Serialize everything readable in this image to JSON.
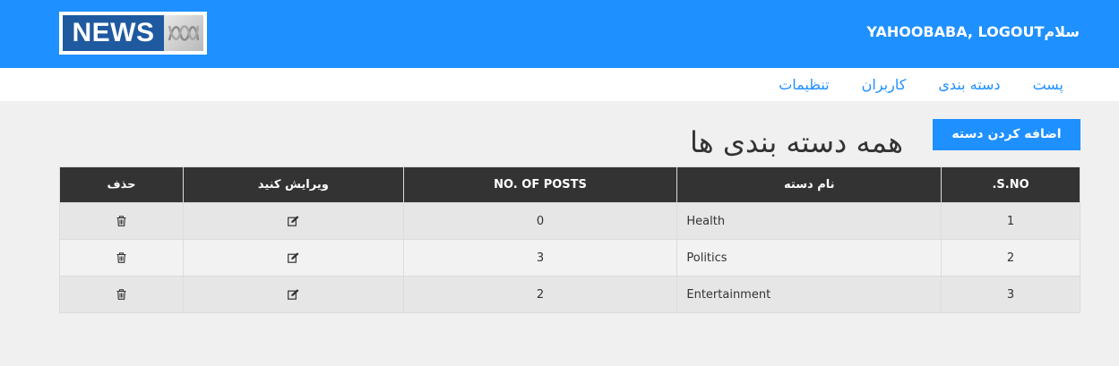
{
  "header": {
    "logo_text": "NEWS",
    "logo_mark_icon": "abc-logo-icon",
    "user_text": "سلامYAHOOBABA, LOGOUT"
  },
  "menu": {
    "items": [
      {
        "label": "پست"
      },
      {
        "label": "دسته بندی"
      },
      {
        "label": "کاربران"
      },
      {
        "label": "تنظیمات"
      }
    ]
  },
  "page": {
    "title": "همه دسته بندی ها",
    "add_button": "اضافه کردن دسته"
  },
  "table": {
    "headers": {
      "sno": "S.NO.",
      "name": "نام دسته",
      "posts": "NO. OF POSTS",
      "edit": "ویرایش کنید",
      "delete": "حذف"
    },
    "rows": [
      {
        "sno": "1",
        "name": "Health",
        "posts": "0"
      },
      {
        "sno": "2",
        "name": "Politics",
        "posts": "3"
      },
      {
        "sno": "3",
        "name": "Entertainment",
        "posts": "2"
      }
    ],
    "edit_icon": "edit-icon",
    "delete_icon": "trash-icon"
  },
  "colors": {
    "primary": "#1e90ff",
    "table_header": "#333333"
  }
}
